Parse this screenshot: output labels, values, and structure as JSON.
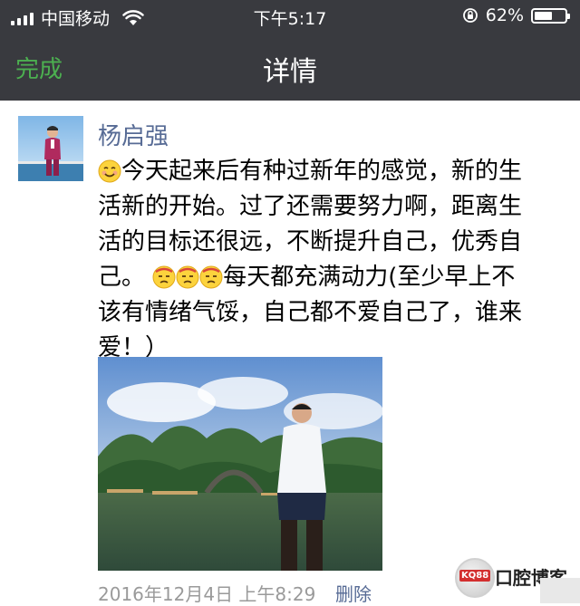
{
  "status_bar": {
    "carrier": "中国移动",
    "time": "下午5:17",
    "battery": "62%",
    "battery_level": 0.62
  },
  "nav": {
    "done_label": "完成",
    "title": "详情"
  },
  "post": {
    "author": "杨启强",
    "text_lines": [
      "今天起来后有种过新年的感觉，新的生",
      "活新的开始。过了还需要努力啊，距离生",
      "活的目标还很远，不断提升自己，优秀自",
      "己。",
      "每天都充满动力(至少早上不",
      "该有情绪气馁，自己都不爱自己了，谁来",
      "爱！）"
    ],
    "timestamp": "2016年12月4日 上午8:29",
    "delete_label": "删除"
  },
  "watermark": {
    "badge": "KQ88",
    "text": "口腔博客"
  },
  "colors": {
    "nav_bg": "#393a3f",
    "done_green": "#4caf50",
    "link_blue": "#576b95"
  },
  "icons": [
    "signal-icon",
    "wifi-icon",
    "rotation-lock-icon",
    "battery-icon",
    "smile-emoji-icon",
    "dizzy-emoji-icon"
  ]
}
